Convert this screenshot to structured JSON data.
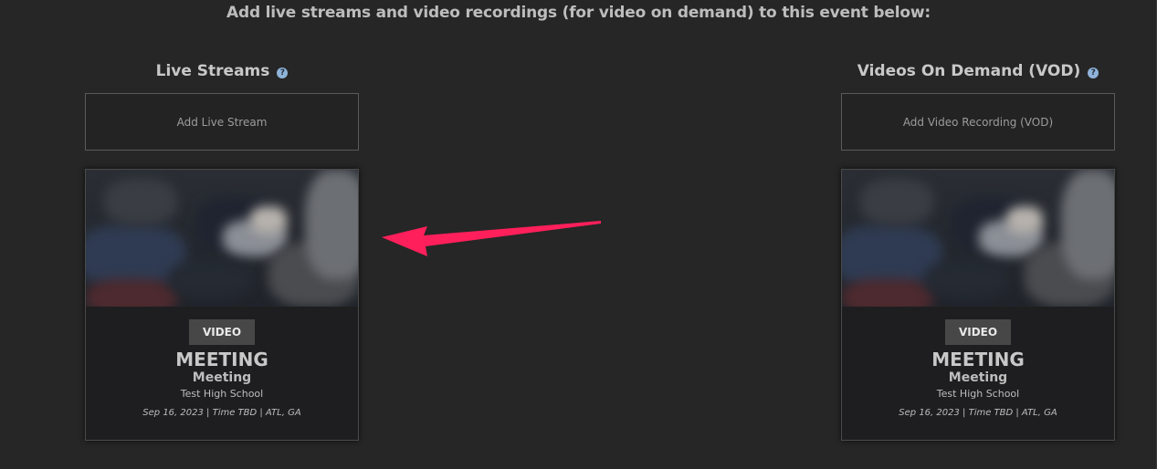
{
  "intro_text": "Add live streams and video recordings (for video on demand) to this event below:",
  "colors": {
    "background": "#262626",
    "accent_arrow": "#ff1f5a",
    "help_icon": "#8fb3d9",
    "tag_bg": "#474747"
  },
  "live": {
    "header": "Live Streams",
    "help_icon": "question-circle-icon",
    "add_button": "Add Live Stream",
    "card": {
      "tag": "VIDEO",
      "title": "MEETING",
      "subtitle": "Meeting",
      "school": "Test High School",
      "meta": "Sep 16, 2023 | Time TBD | ATL, GA"
    }
  },
  "vod": {
    "header": "Videos On Demand (VOD)",
    "help_icon": "question-circle-icon",
    "add_button": "Add Video Recording (VOD)",
    "card": {
      "tag": "VIDEO",
      "title": "MEETING",
      "subtitle": "Meeting",
      "school": "Test High School",
      "meta": "Sep 16, 2023 | Time TBD | ATL, GA"
    }
  },
  "annotation_arrow": "arrow-left-icon"
}
